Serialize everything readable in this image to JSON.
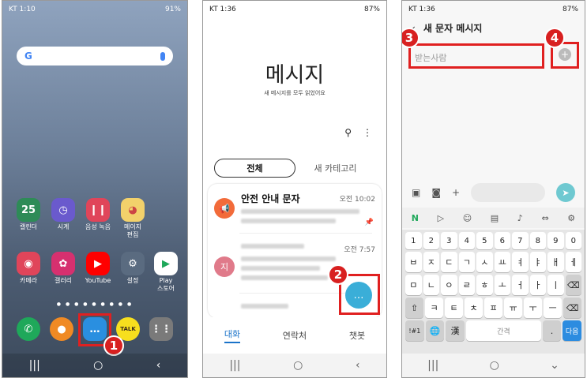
{
  "phone1": {
    "status": {
      "carrier_time": "KT 1:10",
      "battery": "91%"
    },
    "apps_row1": [
      {
        "label": "캘린더",
        "glyph": "25",
        "color": "#2e8b57"
      },
      {
        "label": "시계",
        "glyph": "◷",
        "color": "#6a5acd"
      },
      {
        "label": "음성 녹음",
        "glyph": "❙❙",
        "color": "#e0455a"
      },
      {
        "label": "메이지\n편집",
        "glyph": "◕",
        "color": "#f2d16b"
      }
    ],
    "apps_row2": [
      {
        "label": "카메라",
        "glyph": "◉",
        "color": "#e0455a"
      },
      {
        "label": "갤러리",
        "glyph": "✿",
        "color": "#d6306f"
      },
      {
        "label": "YouTube",
        "glyph": "▶",
        "color": "#ff0000"
      },
      {
        "label": "설정",
        "glyph": "⚙",
        "color": "#5a6b80"
      },
      {
        "label": "Play\n스토어",
        "glyph": "▶",
        "color": "#ffffff"
      }
    ],
    "dock": [
      {
        "glyph": "✆",
        "color": "#1fa85a"
      },
      {
        "glyph": "●",
        "color": "#f08a24"
      },
      {
        "glyph": "…",
        "color": "#2a8fe0"
      },
      {
        "glyph": "TALK",
        "color": "#f7df1e"
      },
      {
        "glyph": "⋮⋮",
        "color": "#7a7a7a"
      }
    ],
    "step": "1"
  },
  "phone2": {
    "status": {
      "carrier_time": "KT 1:36",
      "battery": "87%"
    },
    "title": "메시지",
    "subtitle": "새 메시지를 모두 읽었어요",
    "tabs": [
      "전체",
      "새 카테고리"
    ],
    "conversations": [
      {
        "avatar": "",
        "name": "안전 안내 문자",
        "time": "오전 10:02",
        "color": "#f26b3a"
      },
      {
        "avatar": "지",
        "name": "",
        "time": "오전 7:57",
        "color": "#e07a8a"
      }
    ],
    "bottom_tabs": [
      "대화",
      "연락처",
      "챗봇"
    ],
    "step": "2"
  },
  "phone3": {
    "status": {
      "carrier_time": "KT 1:36",
      "battery": "87%"
    },
    "header": "새 문자 메시지",
    "recipient_placeholder": "받는사람",
    "number_row": [
      "1",
      "2",
      "3",
      "4",
      "5",
      "6",
      "7",
      "8",
      "9",
      "0"
    ],
    "row1": [
      "ㅂ",
      "ㅈ",
      "ㄷ",
      "ㄱ",
      "ㅅ",
      "ㅛ",
      "ㅕ",
      "ㅑ",
      "ㅐ",
      "ㅔ"
    ],
    "row2": [
      "ㅁ",
      "ㄴ",
      "ㅇ",
      "ㄹ",
      "ㅎ",
      "ㅗ",
      "ㅓ",
      "ㅏ",
      "ㅣ",
      "⌫"
    ],
    "row3": [
      "⇧",
      "ㅋ",
      "ㅌ",
      "ㅊ",
      "ㅍ",
      "ㅠ",
      "ㅜ",
      "ㅡ",
      "⌫"
    ],
    "row4": [
      "!#1",
      "🌐",
      "漢",
      "간격",
      ".",
      "다음"
    ],
    "step3": "3",
    "step4": "4"
  }
}
